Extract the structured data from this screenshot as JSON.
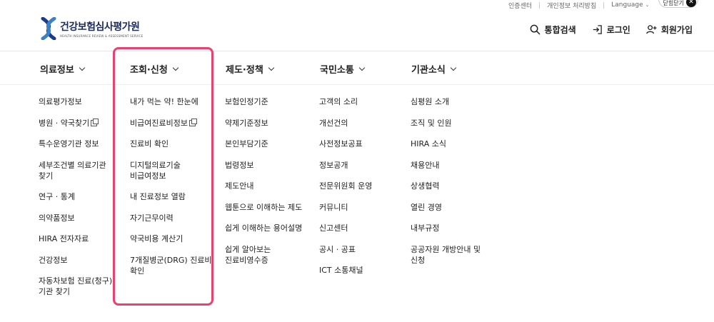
{
  "util": {
    "cert": "인증센터",
    "privacy": "개인정보 처리방침",
    "language": "Language",
    "close_text": "닫힘닫기"
  },
  "logo": {
    "name": "건강보험심사평가원",
    "english": "HEALTH INSURANCE REVIEW & ASSESSMENT SERVICE"
  },
  "header": {
    "search": "통합검색",
    "login": "로그인",
    "signup": "회원가입"
  },
  "nav": [
    {
      "label": "의료정보"
    },
    {
      "label": "조회·신청"
    },
    {
      "label": "제도·정책"
    },
    {
      "label": "국민소통"
    },
    {
      "label": "기관소식"
    }
  ],
  "columns": {
    "col1": [
      "의료평가정보",
      "병원 · 약국찾기",
      "특수운영기관 정보",
      "세부조건별 의료기관",
      "찾기",
      "연구 · 통계",
      "의약품정보",
      "HIRA 전자자료",
      "건강정보",
      "자동차보험 진료(청구)",
      "기관 찾기"
    ],
    "col2": [
      "내가 먹는 약! 한눈에",
      "비급여진료비정보",
      "진료비 확인",
      "디지털의료기술",
      "비급여정보",
      "내 진료정보 열람",
      "자기근무이력",
      "약국비용 계산기",
      "7개질병군(DRG) 진료비",
      "확인"
    ],
    "col3": [
      "보험인정기준",
      "약제기준정보",
      "본인부담기준",
      "법령정보",
      "제도안내",
      "웹툰으로 이해하는 제도",
      "쉽게 이해하는 용어설명",
      "쉽게 알아보는",
      "진료비영수증"
    ],
    "col4": [
      "고객의 소리",
      "개선건의",
      "사전정보공표",
      "정보공개",
      "전문위원회 운영",
      "커뮤니티",
      "신고센터",
      "공시 · 공표",
      "ICT 소통채널"
    ],
    "col5": [
      "심평원 소개",
      "조직 및 인원",
      "HIRA 소식",
      "채용안내",
      "상생협력",
      "열린 경영",
      "내부규정",
      "공공자원 개방안내 및",
      "신청"
    ]
  },
  "colors": {
    "highlight": "#e8436f",
    "logo_blue": "#1a2a5a"
  }
}
